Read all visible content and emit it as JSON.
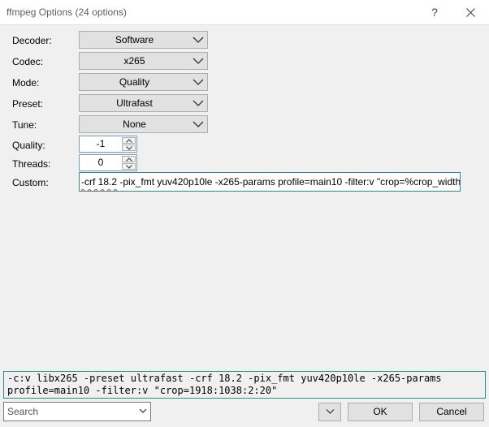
{
  "window": {
    "title": "ffmpeg Options (24 options)",
    "help_label": "?"
  },
  "fields": {
    "decoder": {
      "label": "Decoder:",
      "value": "Software"
    },
    "codec": {
      "label": "Codec:",
      "value": "x265"
    },
    "mode": {
      "label": "Mode:",
      "value": "Quality"
    },
    "preset": {
      "label": "Preset:",
      "value": "Ultrafast"
    },
    "tune": {
      "label": "Tune:",
      "value": "None"
    },
    "quality": {
      "label": "Quality:",
      "value": "-1"
    },
    "threads": {
      "label": "Threads:",
      "value": "0"
    },
    "custom": {
      "label": "Custom:",
      "value": "-crf 18.2 -pix_fmt yuv420p10le -x265-params profile=main10 -filter:v \"crop=%crop_width%:%crop_height%\""
    }
  },
  "command_line": "-c:v libx265 -preset ultrafast -crf 18.2 -pix_fmt yuv420p10le -x265-params\nprofile=main10 -filter:v \"crop=1918:1038:2:20\"",
  "footer": {
    "search_placeholder": "Search",
    "ok_label": "OK",
    "cancel_label": "Cancel"
  },
  "icons": {
    "close": "close-icon",
    "dropdown": "chevron-down-icon",
    "spin_up": "caret-up-icon",
    "spin_down": "caret-down-icon"
  },
  "colors": {
    "focus_border": "#2c8c8c",
    "button_face": "#e1e1e1",
    "window_bg": "#f0f0f0"
  }
}
